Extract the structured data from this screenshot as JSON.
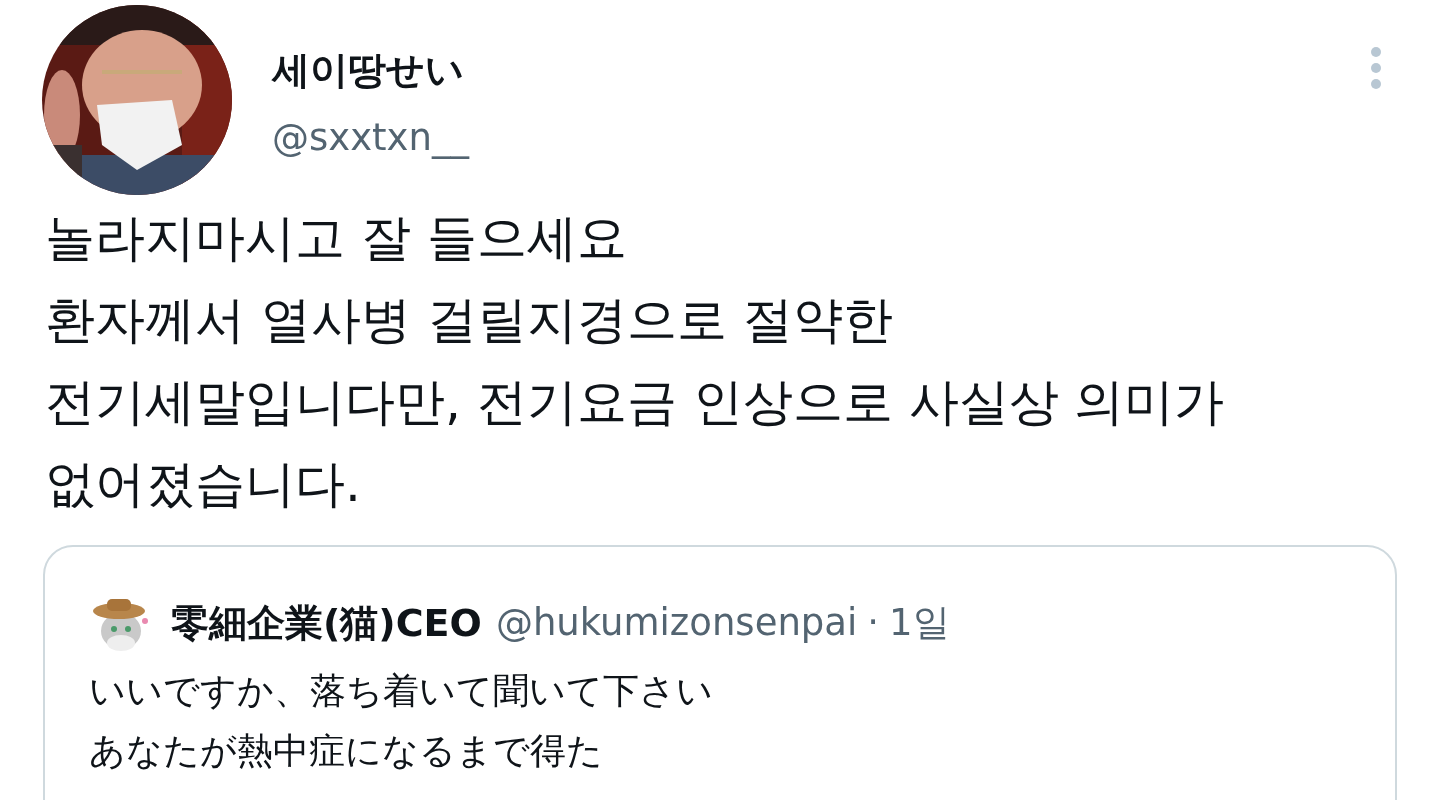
{
  "author": {
    "name": "세이땅せい",
    "handle": "@sxxtxn__"
  },
  "text_lines": [
    "놀라지마시고 잘 들으세요",
    "환자께서 열사병 걸릴지경으로 절약한",
    "전기세말입니다만, 전기요금 인상으로 사실상 의미가",
    "없어졌습니다."
  ],
  "quoted_tweet": {
    "author_name": "零細企業(猫)CEO",
    "handle": "@hukumizonsenpai",
    "separator": "·",
    "time": "1일",
    "text_lines": [
      "いいですか、落ち着いて聞いて下さい",
      "あなたが熱中症になるまで得た"
    ]
  }
}
